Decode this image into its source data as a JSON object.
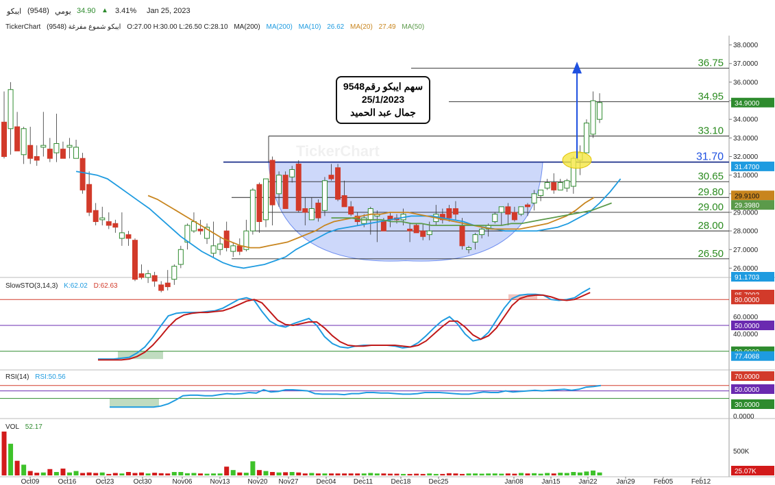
{
  "header": {
    "name": "ايبكو",
    "code": "(9548)",
    "period": "يومي",
    "price": "34.90",
    "change": "3.41%",
    "date": "Jan 25, 2023"
  },
  "info": {
    "brand": "TickerChart",
    "name_code": "ايبكو شموع مفرغة (9548)",
    "ohlc": "O:27.00 H:30.00 L:26.50 C:28.10",
    "ma_label": "MA(200)",
    "ma200": "MA(200)",
    "ma10": "MA(10)",
    "ma10_val": "26.62",
    "ma20": "MA(20)",
    "ma20_val": "27.49",
    "ma50": "MA(50)"
  },
  "annotation": {
    "line1": "سهم ايبكو رقم9548",
    "line2": "25/1/2023",
    "line3": "جمال عبد الحميد"
  },
  "watermark": "TickerChart",
  "stoch_label": {
    "name": "SlowSTO(3,14,3)",
    "k": "K:62.02",
    "d": "D:62.63"
  },
  "rsi_label": {
    "name": "RSI(14)",
    "val": "RSI:50.56"
  },
  "vol_label": {
    "name": "VOL",
    "val": "52.17"
  },
  "colors": {
    "up": "#2e8b2e",
    "down": "#d23a2a",
    "ma10": "#1e9be0",
    "ma20": "#c8851e",
    "ma50": "#5b9a4a",
    "level": "#2a8a1e",
    "blue_level": "#1e50e0",
    "cup": "#6f8ff0"
  },
  "chart_data": [
    {
      "type": "candlestick",
      "pane": "price",
      "x_ticks": [
        "Oct09",
        "Oct16",
        "Oct23",
        "Oct30",
        "Nov06",
        "Nov13",
        "Nov20",
        "Nov27",
        "Dec04",
        "Dec11",
        "Dec18",
        "Dec25",
        "Jan08",
        "Jan15",
        "Jan22",
        "Jan29",
        "Feb05",
        "Feb12"
      ],
      "y_ticks": [
        "38.0000",
        "37.0000",
        "36.0000",
        "35.0000",
        "34.0000",
        "33.0000",
        "32.0000",
        "31.0000",
        "30.0000",
        "29.0000",
        "28.0000",
        "27.0000",
        "26.0000"
      ],
      "ylim": [
        25.5,
        38.5
      ],
      "candles": [
        [
          33.85,
          35.5,
          31.9,
          32.0
        ],
        [
          33.5,
          36.0,
          32.1,
          35.6
        ],
        [
          33.6,
          34.4,
          32.4,
          32.3
        ],
        [
          32.1,
          33.6,
          31.6,
          33.5
        ],
        [
          32.6,
          33.6,
          31.6,
          31.9
        ],
        [
          32.0,
          32.6,
          31.5,
          31.8
        ],
        [
          32.5,
          34.4,
          32.0,
          32.6
        ],
        [
          32.4,
          33.0,
          31.7,
          31.9
        ],
        [
          32.2,
          34.3,
          31.7,
          32.7
        ],
        [
          32.4,
          32.8,
          32.0,
          31.9
        ],
        [
          32.5,
          33.0,
          31.9,
          32.6
        ],
        [
          31.9,
          32.9,
          31.9,
          32.5
        ],
        [
          31.9,
          32.2,
          30.0,
          30.2
        ],
        [
          30.5,
          31.2,
          28.8,
          29.0
        ],
        [
          29.1,
          29.5,
          28.3,
          28.5
        ],
        [
          28.6,
          29.3,
          28.3,
          28.7
        ],
        [
          28.5,
          29.0,
          28.1,
          28.3
        ],
        [
          28.4,
          28.6,
          27.9,
          28.2
        ],
        [
          27.6,
          29.0,
          27.2,
          27.9
        ],
        [
          27.8,
          28.0,
          27.2,
          27.6
        ],
        [
          27.5,
          27.6,
          25.3,
          25.4
        ],
        [
          25.7,
          26.2,
          25.4,
          25.5
        ],
        [
          25.5,
          25.9,
          25.2,
          25.7
        ],
        [
          25.6,
          25.8,
          25.0,
          25.3
        ],
        [
          25.1,
          25.3,
          24.7,
          24.8
        ],
        [
          25.2,
          25.9,
          24.8,
          25.0
        ],
        [
          25.4,
          26.2,
          25.1,
          26.1
        ],
        [
          26.2,
          27.2,
          26.0,
          27.0
        ],
        [
          27.4,
          28.4,
          27.0,
          28.3
        ],
        [
          28.0,
          29.0,
          27.9,
          28.5
        ],
        [
          28.1,
          28.6,
          27.8,
          28.0
        ],
        [
          27.6,
          28.4,
          27.3,
          28.2
        ],
        [
          26.8,
          28.5,
          26.6,
          27.2
        ],
        [
          27.0,
          27.7,
          26.7,
          27.3
        ],
        [
          28.0,
          28.5,
          26.9,
          27.1
        ],
        [
          26.9,
          27.4,
          26.6,
          27.2
        ],
        [
          27.2,
          27.6,
          26.7,
          26.9
        ],
        [
          27.0,
          28.6,
          26.9,
          28.0
        ],
        [
          28.0,
          30.3,
          27.8,
          30.2
        ],
        [
          30.5,
          30.6,
          27.9,
          28.5
        ],
        [
          28.6,
          30.8,
          28.2,
          30.8
        ],
        [
          31.8,
          32.0,
          28.3,
          29.4
        ],
        [
          30.0,
          31.2,
          29.3,
          31.0
        ],
        [
          31.0,
          31.2,
          29.5,
          29.2
        ],
        [
          30.9,
          31.5,
          30.6,
          31.3
        ],
        [
          31.6,
          31.8,
          29.0,
          29.1
        ],
        [
          29.2,
          29.8,
          28.3,
          29.0
        ],
        [
          28.6,
          29.8,
          28.6,
          29.2
        ],
        [
          29.5,
          29.7,
          28.5,
          28.7
        ],
        [
          29.1,
          30.9,
          28.8,
          30.7
        ],
        [
          31.0,
          31.6,
          30.7,
          30.8
        ],
        [
          31.4,
          31.6,
          29.6,
          29.7
        ],
        [
          29.9,
          30.7,
          29.4,
          29.3
        ],
        [
          29.3,
          29.6,
          28.8,
          28.9
        ],
        [
          28.8,
          29.0,
          28.3,
          28.5
        ],
        [
          28.4,
          28.9,
          28.2,
          28.7
        ],
        [
          28.6,
          29.3,
          27.8,
          29.2
        ],
        [
          28.8,
          29.1,
          27.4,
          28.9
        ],
        [
          28.5,
          28.7,
          28.0,
          28.0
        ],
        [
          28.8,
          29.0,
          28.2,
          28.6
        ],
        [
          28.7,
          28.9,
          28.4,
          28.6
        ],
        [
          28.6,
          29.2,
          28.3,
          28.9
        ],
        [
          28.1,
          28.4,
          27.4,
          28.0
        ],
        [
          28.3,
          28.4,
          27.9,
          27.9
        ],
        [
          28.0,
          28.4,
          27.5,
          27.7
        ],
        [
          27.8,
          28.5,
          27.5,
          28.0
        ],
        [
          28.5,
          29.4,
          28.3,
          28.9
        ],
        [
          28.9,
          29.2,
          28.4,
          28.6
        ],
        [
          29.2,
          29.4,
          28.5,
          28.7
        ],
        [
          29.2,
          29.6,
          28.6,
          28.9
        ],
        [
          28.3,
          28.7,
          27.0,
          27.2
        ],
        [
          27.0,
          27.2,
          26.8,
          27.1
        ],
        [
          27.4,
          27.9,
          27.0,
          27.8
        ],
        [
          27.8,
          28.2,
          27.6,
          28.1
        ],
        [
          28.1,
          28.4,
          27.7,
          28.3
        ],
        [
          28.5,
          29.0,
          28.4,
          28.9
        ],
        [
          29.0,
          29.2,
          28.3,
          29.3
        ],
        [
          29.3,
          29.5,
          28.3,
          28.9
        ],
        [
          29.0,
          29.3,
          28.5,
          28.6
        ],
        [
          28.9,
          29.3,
          28.8,
          29.3
        ],
        [
          29.4,
          29.5,
          28.8,
          29.3
        ],
        [
          29.5,
          30.2,
          29.1,
          30.0
        ],
        [
          29.9,
          30.2,
          29.6,
          30.2
        ],
        [
          30.3,
          30.8,
          30.2,
          30.6
        ],
        [
          30.6,
          31.1,
          30.0,
          30.2
        ],
        [
          30.2,
          30.8,
          30.2,
          30.6
        ],
        [
          30.3,
          30.8,
          30.1,
          30.7
        ],
        [
          30.4,
          32.0,
          30.0,
          31.9
        ],
        [
          31.8,
          32.6,
          31.0,
          32.2
        ],
        [
          32.2,
          34.0,
          32.2,
          33.8
        ],
        [
          33.2,
          35.5,
          33.0,
          35.0
        ],
        [
          34.0,
          35.4,
          33.8,
          34.9
        ]
      ],
      "ma10": [
        31.2,
        31.1,
        31.0,
        30.8,
        30.4,
        30.0,
        29.6,
        29.2,
        28.7,
        28.2,
        27.7,
        27.3,
        26.9,
        26.6,
        26.3,
        26.1,
        26.0,
        26.1,
        26.2,
        26.4,
        26.6,
        27.0,
        27.3,
        27.6,
        27.9,
        28.1,
        28.2,
        28.3,
        28.4,
        28.5,
        28.6,
        28.7,
        28.8,
        28.8,
        28.8,
        28.7,
        28.6,
        28.5,
        28.3,
        28.2,
        28.1,
        28.0,
        28.0,
        28.0,
        28.0,
        28.1,
        28.2,
        28.4,
        28.7,
        29.0,
        29.5,
        30.1,
        30.8
      ],
      "ma20": [
        29.9,
        29.7,
        29.4,
        29.1,
        28.8,
        28.5,
        28.2,
        27.9,
        27.6,
        27.4,
        27.2,
        27.1,
        27.1,
        27.2,
        27.3,
        27.4,
        27.6,
        27.8,
        28.0,
        28.3,
        28.5,
        28.6,
        28.7,
        28.8,
        28.9,
        28.9,
        29.0,
        29.0,
        29.0,
        28.9,
        28.8,
        28.7,
        28.6,
        28.5,
        28.4,
        28.3,
        28.2,
        28.1,
        28.1,
        28.1,
        28.1,
        28.2,
        28.3,
        28.4,
        28.6,
        28.8,
        29.1,
        29.5,
        29.8
      ],
      "ma50": [
        28.7,
        28.7,
        28.7,
        28.6,
        28.6,
        28.6,
        28.5,
        28.5,
        28.4,
        28.4,
        28.3,
        28.3,
        28.3,
        28.3,
        28.3,
        28.3,
        28.3,
        28.3,
        28.4,
        28.4,
        28.5,
        28.6,
        28.7,
        28.8,
        28.9,
        29.0,
        29.1,
        29.3,
        29.5
      ],
      "levels": [
        "36.75",
        "34.95",
        "33.10",
        "31.70",
        "30.65",
        "29.80",
        "29.00",
        "28.00",
        "26.50"
      ],
      "price_tags": [
        "34.9000",
        "31.4700",
        "29.9100",
        "29.3980",
        "91.1703"
      ]
    },
    {
      "type": "line",
      "pane": "stochastic",
      "y_ticks": [
        "60.0000",
        "40.0000"
      ],
      "levels": [
        "80.0000",
        "50.0000",
        "20.0000"
      ],
      "k": [
        11,
        11,
        11,
        12,
        13,
        18,
        25,
        36,
        49,
        61,
        64,
        65,
        65,
        65,
        66,
        67,
        70,
        75,
        80,
        82,
        79,
        66,
        55,
        50,
        48,
        52,
        55,
        58,
        50,
        37,
        29,
        25,
        24,
        26,
        27,
        27,
        27,
        27,
        26,
        24,
        25,
        30,
        38,
        47,
        55,
        60,
        52,
        40,
        32,
        34,
        42,
        56,
        70,
        81,
        85,
        86,
        86,
        85,
        80,
        79,
        80,
        82,
        88,
        93
      ],
      "d": [
        10,
        10,
        10,
        10,
        11,
        14,
        19,
        27,
        37,
        48,
        57,
        62,
        64,
        65,
        65,
        66,
        67,
        70,
        74,
        78,
        80,
        76,
        66,
        56,
        51,
        50,
        52,
        54,
        54,
        47,
        38,
        31,
        27,
        26,
        26,
        27,
        27,
        27,
        27,
        26,
        25,
        27,
        32,
        40,
        48,
        55,
        55,
        48,
        39,
        34,
        38,
        47,
        60,
        73,
        81,
        84,
        85,
        85,
        83,
        80,
        79,
        80,
        84,
        88
      ],
      "tags": [
        "85.7093",
        "80.0000",
        "50.0000",
        "20.0000",
        "77.4068"
      ]
    },
    {
      "type": "line",
      "pane": "rsi",
      "y_ticks": [
        "0.0000"
      ],
      "levels": [
        "70.0000",
        "50.0000",
        "30.0000"
      ],
      "rsi": [
        20,
        20,
        20,
        20,
        20,
        20,
        20,
        22,
        26,
        33,
        41,
        42,
        42,
        41,
        41,
        43,
        45,
        44,
        45,
        47,
        46,
        52,
        48,
        49,
        52,
        52,
        51,
        50,
        45,
        44,
        44,
        44,
        43,
        45,
        45,
        47,
        47,
        46,
        46,
        45,
        44,
        44,
        45,
        47,
        47,
        47,
        46,
        45,
        44,
        44,
        46,
        48,
        47,
        47,
        50,
        48,
        49,
        50,
        51,
        50,
        51,
        52,
        53,
        51,
        53,
        57,
        58,
        60
      ],
      "tags": [
        "70.0000",
        "50.0000",
        "30.0000"
      ]
    },
    {
      "type": "bar",
      "pane": "volume",
      "y_ticks": [
        "500K"
      ],
      "tag": "25.07K",
      "volume": [
        900,
        650,
        300,
        220,
        90,
        55,
        60,
        130,
        70,
        140,
        60,
        90,
        50,
        60,
        50,
        60,
        30,
        50,
        40,
        70,
        50,
        60,
        40,
        55,
        45,
        40,
        70,
        70,
        45,
        50,
        40,
        35,
        40,
        40,
        180,
        110,
        60,
        55,
        290,
        110,
        90,
        70,
        60,
        65,
        70,
        60,
        40,
        50,
        40,
        40,
        40,
        40,
        40,
        40,
        40,
        40,
        50,
        40,
        40,
        35,
        35,
        30,
        30,
        35,
        30,
        40,
        30,
        30,
        45,
        40,
        30,
        40,
        40,
        35,
        40,
        40,
        35,
        40,
        35,
        50,
        40,
        45,
        35,
        50,
        40,
        55,
        50,
        70,
        60,
        80,
        100,
        60
      ]
    }
  ]
}
